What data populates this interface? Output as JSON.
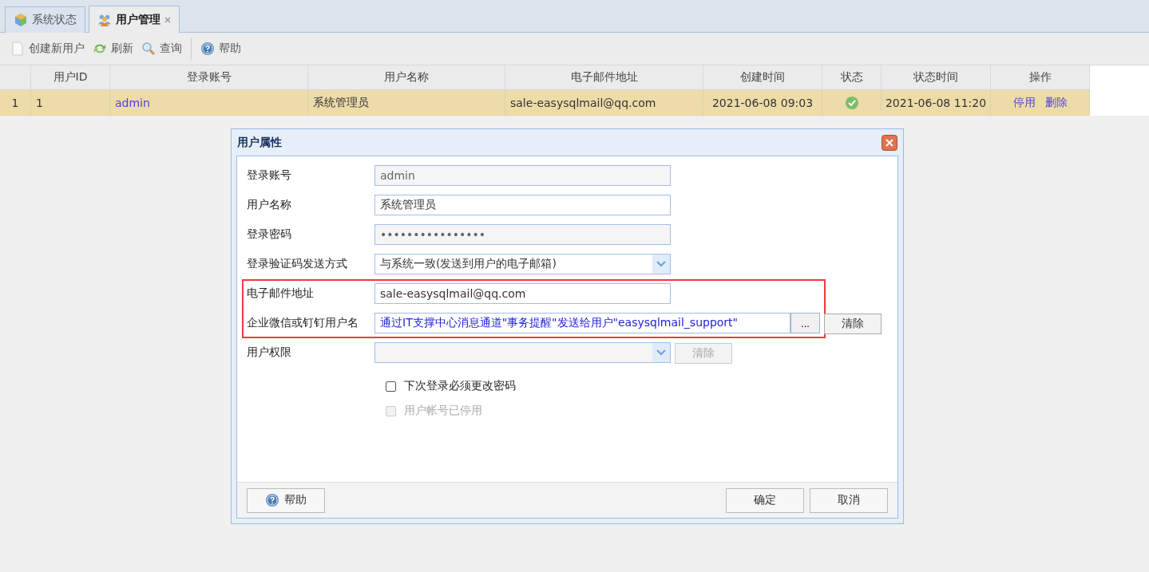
{
  "tabs": [
    {
      "label": "系统状态",
      "selected": false,
      "closable": false
    },
    {
      "label": "用户管理",
      "selected": true,
      "closable": true
    }
  ],
  "toolbar": [
    {
      "kind": "new",
      "label": "创建新用户"
    },
    {
      "kind": "refresh",
      "label": "刷新"
    },
    {
      "kind": "search",
      "label": "查询"
    },
    {
      "kind": "separator"
    },
    {
      "kind": "help",
      "label": "帮助"
    }
  ],
  "table": {
    "columns": [
      "用户ID",
      "登录账号",
      "用户名称",
      "电子邮件地址",
      "创建时间",
      "状态",
      "状态时间",
      "操作"
    ],
    "rows": [
      {
        "row_number": "1",
        "selected": true,
        "user_id": "1",
        "account": "admin",
        "name": "系统管理员",
        "email": "sale-easysqlmail@qq.com",
        "created": "2021-06-08 09:03",
        "active": true,
        "status_time": "2021-06-08 11:20",
        "actions": [
          "停用",
          "删除"
        ]
      }
    ]
  },
  "dialog": {
    "title": "用户属性",
    "fields": [
      {
        "kind": "text",
        "label": "登录账号",
        "value": "admin",
        "disabled": true,
        "highlighted": false
      },
      {
        "kind": "text",
        "label": "用户名称",
        "value": "系统管理员",
        "disabled": false,
        "highlighted": false
      },
      {
        "kind": "text",
        "label": "登录密码",
        "value": "••••••••••••••••",
        "disabled": true,
        "highlighted": false
      },
      {
        "kind": "select",
        "label": "登录验证码发送方式",
        "value": "与系统一致(发送到用户的电子邮箱)",
        "disabled": false,
        "highlighted": false
      },
      {
        "kind": "text",
        "label": "电子邮件地址",
        "value": "sale-easysqlmail@qq.com",
        "disabled": false,
        "highlighted": true
      },
      {
        "kind": "picker",
        "label": "企业微信或钉钉用户名",
        "value": "通过IT支撑中心消息通道\"事务提醒\"发送给用户\"easysqlmail_support\"",
        "disabled": false,
        "highlighted": true,
        "browse": "...",
        "clear": {
          "label": "清除",
          "disabled": false
        }
      },
      {
        "kind": "select",
        "label": "用户权限",
        "disabled": true,
        "highlighted": false,
        "clear": {
          "label": "清除",
          "disabled": true
        }
      }
    ],
    "checkboxes": [
      {
        "label": "下次登录必须更改密码",
        "checked": false,
        "disabled": false
      },
      {
        "label": "用户帐号已停用",
        "checked": false,
        "disabled": true
      }
    ],
    "help_button": "帮助",
    "buttons": [
      "确定",
      "取消"
    ]
  }
}
